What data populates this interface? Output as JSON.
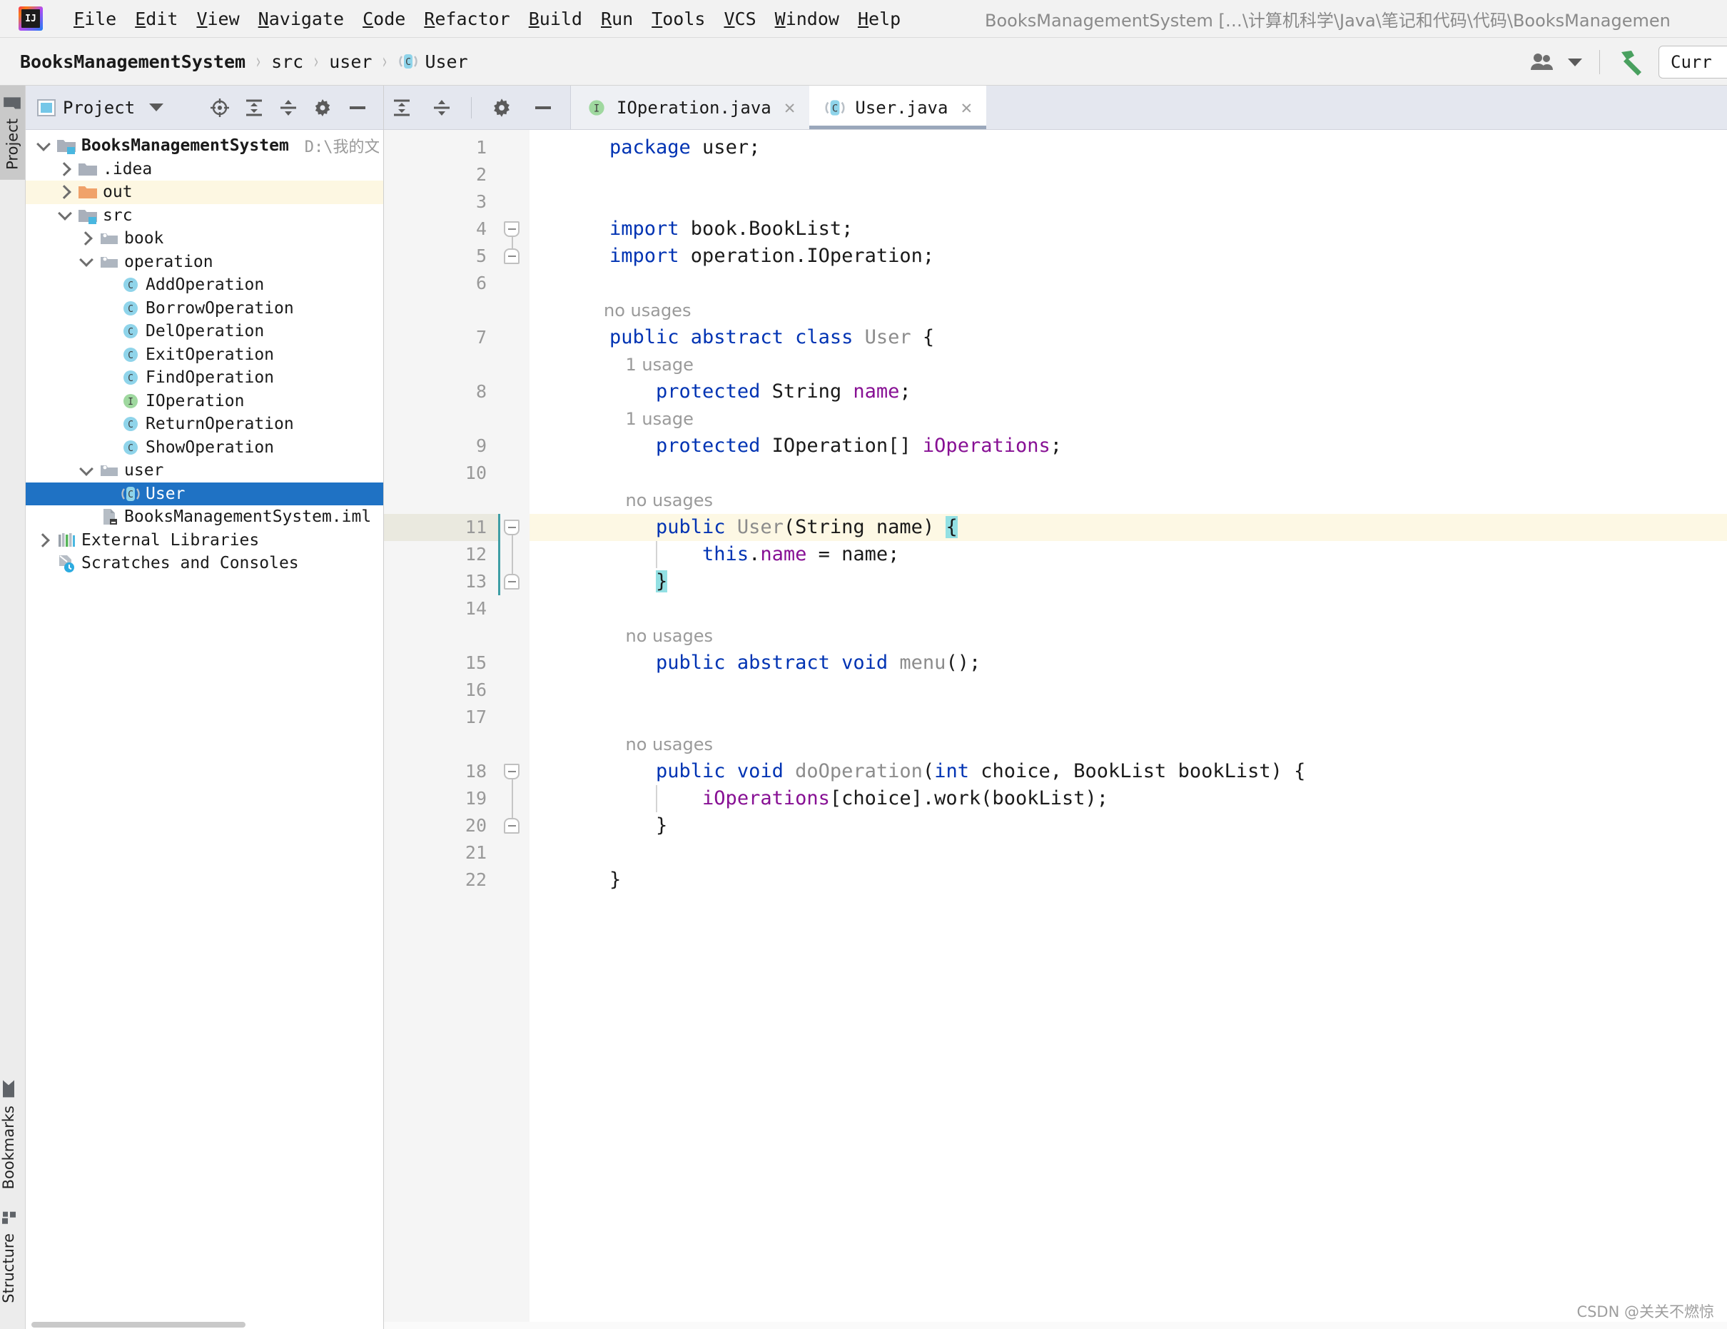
{
  "window": {
    "title": "BooksManagementSystem […\\计算机科学\\Java\\笔记和代码\\代码\\BooksManagemen",
    "logo_text": "IJ"
  },
  "menubar": {
    "items": [
      {
        "label": "File",
        "mnemonic": "F"
      },
      {
        "label": "Edit",
        "mnemonic": "E"
      },
      {
        "label": "View",
        "mnemonic": "V"
      },
      {
        "label": "Navigate",
        "mnemonic": "N"
      },
      {
        "label": "Code",
        "mnemonic": "C"
      },
      {
        "label": "Refactor",
        "mnemonic": "R"
      },
      {
        "label": "Build",
        "mnemonic": "B"
      },
      {
        "label": "Run",
        "mnemonic": "R"
      },
      {
        "label": "Tools",
        "mnemonic": "T"
      },
      {
        "label": "VCS",
        "mnemonic": "V"
      },
      {
        "label": "Window",
        "mnemonic": "W"
      },
      {
        "label": "Help",
        "mnemonic": "H"
      }
    ]
  },
  "navbar": {
    "breadcrumbs": [
      {
        "label": "BooksManagementSystem",
        "icon": "none",
        "bold": true
      },
      {
        "label": "src",
        "icon": "none",
        "bold": false
      },
      {
        "label": "user",
        "icon": "none",
        "bold": false
      },
      {
        "label": "User",
        "icon": "class-icon",
        "bold": false
      }
    ],
    "separator": "›",
    "run_config_label": "Curr",
    "icons": [
      "people-icon",
      "chevron-down-icon",
      "build-hammer-icon"
    ]
  },
  "stripe": {
    "top": [
      {
        "label": "Project",
        "icon": "project-folder-icon",
        "active": true
      }
    ],
    "bottom": [
      {
        "label": "Structure",
        "icon": "structure-icon",
        "active": false
      },
      {
        "label": "Bookmarks",
        "icon": "bookmark-icon",
        "active": false
      }
    ]
  },
  "project_panel": {
    "title": "Project",
    "actions": [
      "locate-target-icon",
      "expand-all-icon",
      "collapse-all-icon",
      "settings-gear-icon",
      "hide-minus-icon"
    ],
    "tree": [
      {
        "label": "BooksManagementSystem",
        "path": "D:\\我的文件\\计算机科学\\",
        "icon": "project-root-folder-icon",
        "depth": 0,
        "twisty": "down",
        "bold": true,
        "state": "normal"
      },
      {
        "label": ".idea",
        "icon": "folder-icon",
        "depth": 1,
        "twisty": "right",
        "state": "normal"
      },
      {
        "label": "out",
        "icon": "folder-excluded-icon",
        "depth": 1,
        "twisty": "right",
        "state": "highlight"
      },
      {
        "label": "src",
        "icon": "source-folder-icon",
        "depth": 1,
        "twisty": "down",
        "state": "normal"
      },
      {
        "label": "book",
        "icon": "package-icon",
        "depth": 2,
        "twisty": "right",
        "state": "normal"
      },
      {
        "label": "operation",
        "icon": "package-icon",
        "depth": 2,
        "twisty": "down",
        "state": "normal"
      },
      {
        "label": "AddOperation",
        "icon": "class-icon",
        "depth": 3,
        "twisty": "none",
        "state": "normal"
      },
      {
        "label": "BorrowOperation",
        "icon": "class-icon",
        "depth": 3,
        "twisty": "none",
        "state": "normal"
      },
      {
        "label": "DelOperation",
        "icon": "class-icon",
        "depth": 3,
        "twisty": "none",
        "state": "normal"
      },
      {
        "label": "ExitOperation",
        "icon": "class-icon",
        "depth": 3,
        "twisty": "none",
        "state": "normal"
      },
      {
        "label": "FindOperation",
        "icon": "class-icon",
        "depth": 3,
        "twisty": "none",
        "state": "normal"
      },
      {
        "label": "IOperation",
        "icon": "interface-icon",
        "depth": 3,
        "twisty": "none",
        "state": "normal"
      },
      {
        "label": "ReturnOperation",
        "icon": "class-icon",
        "depth": 3,
        "twisty": "none",
        "state": "normal"
      },
      {
        "label": "ShowOperation",
        "icon": "class-icon",
        "depth": 3,
        "twisty": "none",
        "state": "normal"
      },
      {
        "label": "user",
        "icon": "package-icon",
        "depth": 2,
        "twisty": "down",
        "state": "normal"
      },
      {
        "label": "User",
        "icon": "abstract-class-icon",
        "depth": 3,
        "twisty": "none",
        "state": "selected"
      },
      {
        "label": "BooksManagementSystem.iml",
        "icon": "iml-file-icon",
        "depth": 2,
        "twisty": "none",
        "state": "normal"
      },
      {
        "label": "External Libraries",
        "icon": "libraries-icon",
        "depth": 0,
        "twisty": "right",
        "state": "normal"
      },
      {
        "label": "Scratches and Consoles",
        "icon": "scratches-icon",
        "depth": 0,
        "twisty": "none",
        "state": "normal"
      }
    ]
  },
  "editor": {
    "tools": [
      "expand-all-icon",
      "collapse-all-icon",
      "settings-gear-icon",
      "hide-minus-icon"
    ],
    "tabs": [
      {
        "label": "IOperation.java",
        "icon": "interface-icon",
        "active": false,
        "close": "✕"
      },
      {
        "label": "User.java",
        "icon": "abstract-class-icon",
        "active": true,
        "close": "✕"
      }
    ],
    "caret_line": 11,
    "lines": [
      {
        "n": 1,
        "segments": [
          {
            "t": "package",
            "c": "kw"
          },
          {
            "t": " user;",
            "c": "pln"
          }
        ]
      },
      {
        "n": 2,
        "segments": []
      },
      {
        "n": 3,
        "segments": []
      },
      {
        "n": 4,
        "segments": [
          {
            "t": "import",
            "c": "kw"
          },
          {
            "t": " book.BookList;",
            "c": "pln"
          }
        ],
        "fold": "start"
      },
      {
        "n": 5,
        "segments": [
          {
            "t": "import",
            "c": "kw"
          },
          {
            "t": " operation.IOperation;",
            "c": "pln"
          }
        ],
        "fold": "end"
      },
      {
        "n": 6,
        "segments": []
      },
      {
        "n": 7,
        "segments": [
          {
            "t": "public abstract class",
            "c": "kw"
          },
          {
            "t": " ",
            "c": "pln"
          },
          {
            "t": "User",
            "c": "cls"
          },
          {
            "t": " {",
            "c": "pln"
          }
        ],
        "hint": "no usages"
      },
      {
        "n": 8,
        "segments": [
          {
            "t": "    ",
            "c": "pln"
          },
          {
            "t": "protected",
            "c": "kw"
          },
          {
            "t": " String ",
            "c": "pln"
          },
          {
            "t": "name",
            "c": "fld"
          },
          {
            "t": ";",
            "c": "pln"
          }
        ],
        "hint": "    1 usage"
      },
      {
        "n": 9,
        "segments": [
          {
            "t": "    ",
            "c": "pln"
          },
          {
            "t": "protected",
            "c": "kw"
          },
          {
            "t": " IOperation[] ",
            "c": "pln"
          },
          {
            "t": "iOperations",
            "c": "fld"
          },
          {
            "t": ";",
            "c": "pln"
          }
        ],
        "hint": "    1 usage"
      },
      {
        "n": 10,
        "segments": []
      },
      {
        "n": 11,
        "segments": [
          {
            "t": "    ",
            "c": "pln"
          },
          {
            "t": "public",
            "c": "kw"
          },
          {
            "t": " ",
            "c": "pln"
          },
          {
            "t": "User",
            "c": "cls"
          },
          {
            "t": "(String name) ",
            "c": "pln"
          },
          {
            "t": "{",
            "c": "brace"
          }
        ],
        "hint": "    no usages",
        "fold": "start"
      },
      {
        "n": 12,
        "segments": [
          {
            "t": "        ",
            "c": "pln"
          },
          {
            "t": "this",
            "c": "kw"
          },
          {
            "t": ".",
            "c": "pln"
          },
          {
            "t": "name",
            "c": "fld"
          },
          {
            "t": " = name;",
            "c": "pln"
          }
        ]
      },
      {
        "n": 13,
        "segments": [
          {
            "t": "    ",
            "c": "pln"
          },
          {
            "t": "}",
            "c": "brace"
          }
        ],
        "fold": "end"
      },
      {
        "n": 14,
        "segments": []
      },
      {
        "n": 15,
        "segments": [
          {
            "t": "    ",
            "c": "pln"
          },
          {
            "t": "public abstract void",
            "c": "kw"
          },
          {
            "t": " ",
            "c": "pln"
          },
          {
            "t": "menu",
            "c": "cls"
          },
          {
            "t": "();",
            "c": "pln"
          }
        ],
        "hint": "    no usages"
      },
      {
        "n": 16,
        "segments": []
      },
      {
        "n": 17,
        "segments": []
      },
      {
        "n": 18,
        "segments": [
          {
            "t": "    ",
            "c": "pln"
          },
          {
            "t": "public void",
            "c": "kw"
          },
          {
            "t": " ",
            "c": "pln"
          },
          {
            "t": "doOperation",
            "c": "cls"
          },
          {
            "t": "(",
            "c": "pln"
          },
          {
            "t": "int",
            "c": "kw"
          },
          {
            "t": " choice, BookList bookList) {",
            "c": "pln"
          }
        ],
        "hint": "    no usages",
        "fold": "start"
      },
      {
        "n": 19,
        "segments": [
          {
            "t": "        ",
            "c": "pln"
          },
          {
            "t": "iOperations",
            "c": "fld"
          },
          {
            "t": "[choice].work(bookList);",
            "c": "pln"
          }
        ]
      },
      {
        "n": 20,
        "segments": [
          {
            "t": "    ",
            "c": "pln"
          },
          {
            "t": "}",
            "c": "pln"
          }
        ],
        "fold": "end"
      },
      {
        "n": 21,
        "segments": []
      },
      {
        "n": 22,
        "segments": [
          {
            "t": "}",
            "c": "pln"
          }
        ]
      }
    ]
  },
  "watermark": "CSDN @关关不燃惊",
  "colors": {
    "keyword": "#0033b3",
    "class_name": "#8c8c8c",
    "field": "#871094",
    "selection": "#1f72c4",
    "caret_line": "#fdf8e4",
    "brace_match": "#93e0e3",
    "panel_header": "#e4e7ef"
  }
}
